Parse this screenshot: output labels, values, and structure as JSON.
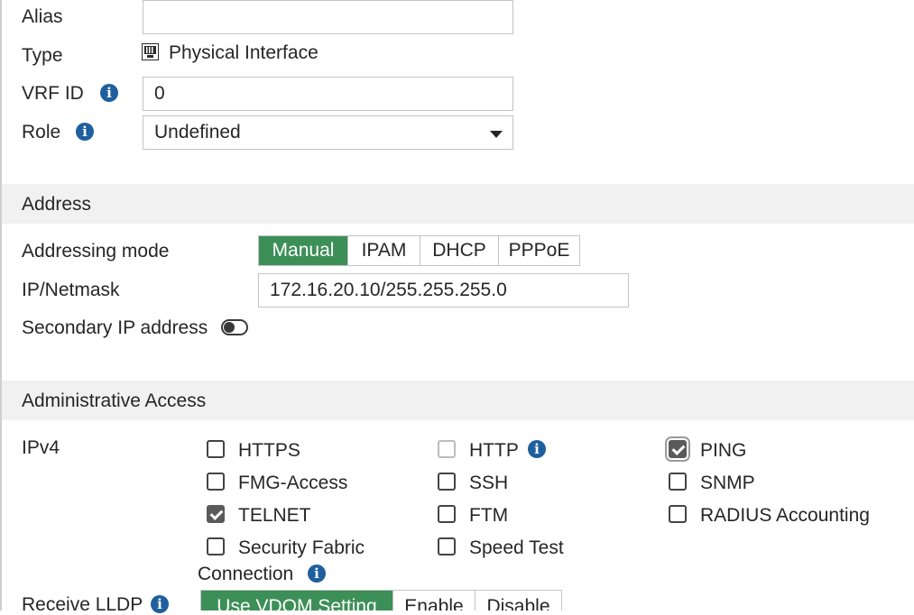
{
  "form": {
    "alias_label": "Alias",
    "alias_value": "",
    "type_label": "Type",
    "type_icon": "physical-interface-icon",
    "type_value": "Physical Interface",
    "vrf_label": "VRF ID",
    "vrf_value": "0",
    "role_label": "Role",
    "role_value": "Undefined"
  },
  "address": {
    "section_title": "Address",
    "mode_label": "Addressing mode",
    "modes": [
      "Manual",
      "IPAM",
      "DHCP",
      "PPPoE"
    ],
    "active_mode": "Manual",
    "ip_label": "IP/Netmask",
    "ip_value": "172.16.20.10/255.255.255.0",
    "secondary_label": "Secondary IP address",
    "secondary_enabled": false
  },
  "admin": {
    "section_title": "Administrative Access",
    "ipv4_label": "IPv4",
    "options": {
      "https": {
        "label": "HTTPS",
        "checked": false
      },
      "http": {
        "label": "HTTP",
        "checked": false,
        "disabled": true
      },
      "ping": {
        "label": "PING",
        "checked": true
      },
      "fmg": {
        "label": "FMG-Access",
        "checked": false
      },
      "ssh": {
        "label": "SSH",
        "checked": false
      },
      "snmp": {
        "label": "SNMP",
        "checked": false
      },
      "telnet": {
        "label": "TELNET",
        "checked": true
      },
      "ftm": {
        "label": "FTM",
        "checked": false
      },
      "radius": {
        "label": "RADIUS Accounting",
        "checked": false
      },
      "fabric_line1": {
        "label": "Security Fabric",
        "checked": false
      },
      "fabric_line2": "Connection",
      "speedtest": {
        "label": "Speed Test",
        "checked": false
      }
    },
    "lldp_label": "Receive LLDP",
    "lldp_options": [
      "Use VDOM Setting",
      "Enable",
      "Disable"
    ],
    "lldp_active": "Use VDOM Setting"
  },
  "colors": {
    "accent_green": "#3d8f58",
    "info_blue": "#1f5f9e",
    "section_bg": "#f1f1f1"
  }
}
